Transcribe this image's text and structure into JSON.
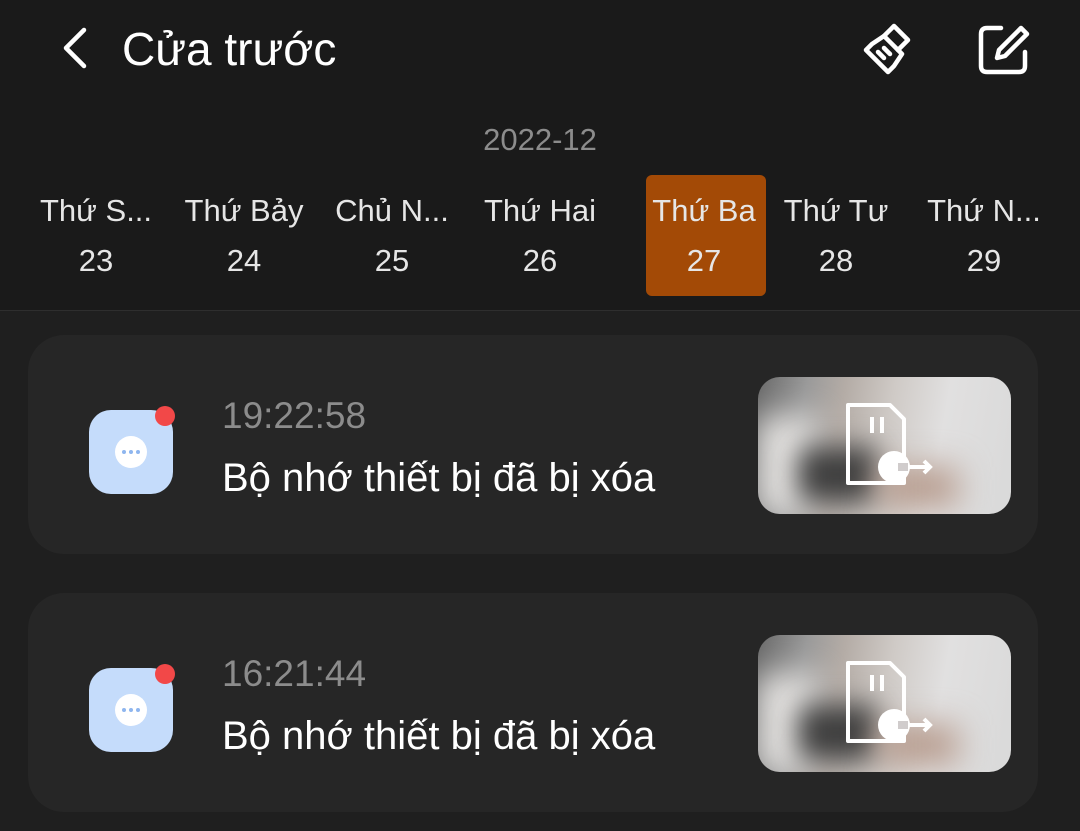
{
  "header": {
    "title": "Cửa trước",
    "back_icon": "back-arrow-icon",
    "clean_icon": "broom-icon",
    "edit_icon": "edit-icon"
  },
  "calendar": {
    "month": "2022-12",
    "days": [
      {
        "name": "Thứ S...",
        "num": "23",
        "selected": false
      },
      {
        "name": "Thứ Bảy",
        "num": "24",
        "selected": false
      },
      {
        "name": "Chủ N...",
        "num": "25",
        "selected": false
      },
      {
        "name": "Thứ Hai",
        "num": "26",
        "selected": false
      },
      {
        "name": "Thứ Ba",
        "num": "27",
        "selected": true
      },
      {
        "name": "Thứ Tư",
        "num": "28",
        "selected": false
      },
      {
        "name": "Thứ N...",
        "num": "29",
        "selected": false
      }
    ],
    "selected_color": "#a34a06"
  },
  "events": [
    {
      "time": "19:22:58",
      "description": "Bộ nhớ thiết bị đã bị xóa",
      "icon": "message-icon",
      "unread": true,
      "thumbnail_icon": "sd-card-removed-icon"
    },
    {
      "time": "16:21:44",
      "description": "Bộ nhớ thiết bị đã bị xóa",
      "icon": "message-icon",
      "unread": true,
      "thumbnail_icon": "sd-card-removed-icon"
    }
  ]
}
